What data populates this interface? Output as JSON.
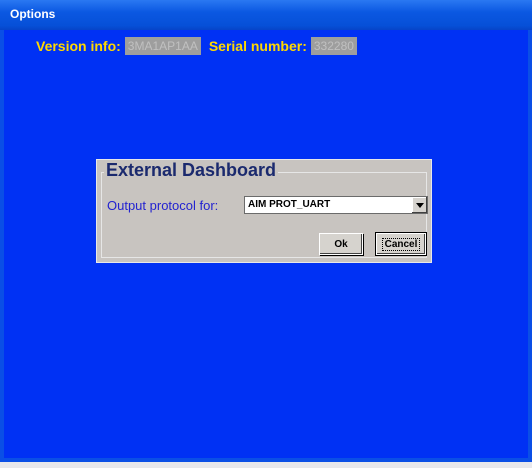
{
  "window": {
    "title": "Options"
  },
  "info": {
    "version_label": "Version info:",
    "version_value": "3MA1AP1AA",
    "serial_label": "Serial number:",
    "serial_value": "332280"
  },
  "dashboard": {
    "group_title": "External Dashboard",
    "protocol_label": "Output protocol for:",
    "protocol_selected": "AIM PROT_UART",
    "ok_label": "Ok",
    "cancel_label": "Cancel"
  },
  "colors": {
    "background": "#0031f4",
    "label_yellow": "#ffd800",
    "title_blue": "#1b2a6e"
  },
  "icons": {
    "dropdown": "chevron-down-icon"
  }
}
